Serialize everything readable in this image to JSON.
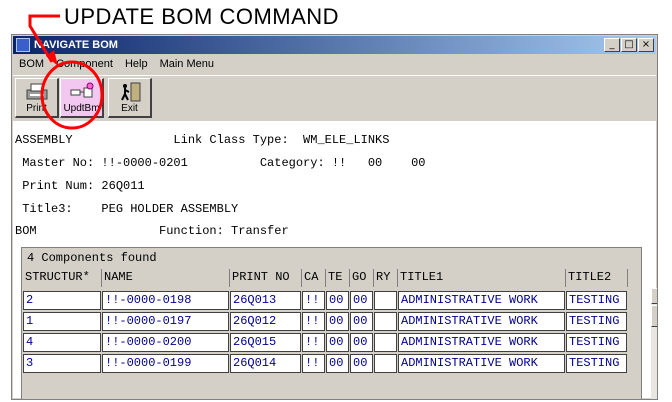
{
  "annotation": {
    "text": "UPDATE BOM COMMAND",
    "color": "#ff0000"
  },
  "window": {
    "title": "NAVIGATE BOM",
    "controls": {
      "minimize": "_",
      "maximize": "□",
      "close": "×"
    }
  },
  "menu": {
    "items": [
      {
        "label": "BOM"
      },
      {
        "label": "Component"
      },
      {
        "label": "Help"
      },
      {
        "label": "Main Menu"
      }
    ]
  },
  "toolbar": {
    "print_label": "Print",
    "updtbm_label": "UpdtBm",
    "exit_label": "Exit",
    "print_icon": "printer-icon",
    "updtbm_icon": "bom-update-icon",
    "exit_icon": "exit-door-icon"
  },
  "info": {
    "line1": "ASSEMBLY              Link Class Type:  WM_ELE_LINKS",
    "line2": " Master No: !!-0000-0201          Category: !!   00    00",
    "line3": " Print Num: 26Q011",
    "line4": " Title3:    PEG HOLDER ASSEMBLY",
    "line5": "BOM                 Function: Transfer"
  },
  "grid": {
    "summary": "4 Components found",
    "columns": [
      "STRUCTUR*",
      "NAME",
      "PRINT NO",
      "CA",
      "TE",
      "GO",
      "RY",
      "TITLE1",
      "TITLE2"
    ],
    "rows": [
      [
        "2",
        "!!-0000-0198",
        "26Q013",
        "!!",
        "00",
        "00",
        "",
        "ADMINISTRATIVE WORK",
        "TESTING"
      ],
      [
        "1",
        "!!-0000-0197",
        "26Q012",
        "!!",
        "00",
        "00",
        "",
        "ADMINISTRATIVE WORK",
        "TESTING"
      ],
      [
        "4",
        "!!-0000-0200",
        "26Q015",
        "!!",
        "00",
        "00",
        "",
        "ADMINISTRATIVE WORK",
        "TESTING"
      ],
      [
        "3",
        "!!-0000-0199",
        "26Q014",
        "!!",
        "00",
        "00",
        "",
        "ADMINISTRATIVE WORK",
        "TESTING"
      ]
    ],
    "scroll_up": "▲"
  }
}
